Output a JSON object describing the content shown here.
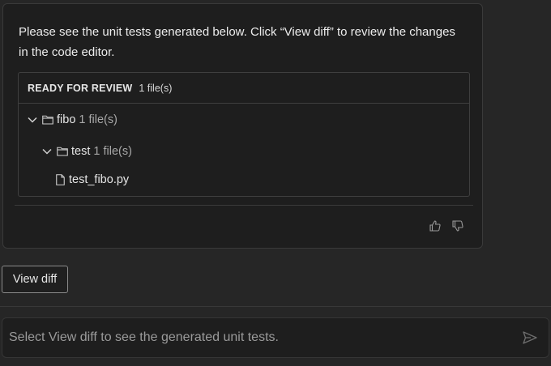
{
  "message": {
    "text": "Please see the unit tests generated below. Click “View diff” to review the changes in the code editor."
  },
  "review": {
    "title": "READY FOR REVIEW",
    "count": "1 file(s)",
    "tree": [
      {
        "name": "fibo",
        "count": "1 file(s)",
        "type": "folder",
        "expanded": true
      },
      {
        "name": "test",
        "count": "1 file(s)",
        "type": "folder",
        "expanded": true
      },
      {
        "name": "test_fibo.py",
        "type": "file"
      }
    ]
  },
  "feedback": {
    "like_icon": "thumbs-up-icon",
    "dislike_icon": "thumbs-down-icon"
  },
  "actions": {
    "view_diff_label": "View diff"
  },
  "chat_input": {
    "placeholder": "Select View diff to see the generated unit tests.",
    "value": ""
  }
}
